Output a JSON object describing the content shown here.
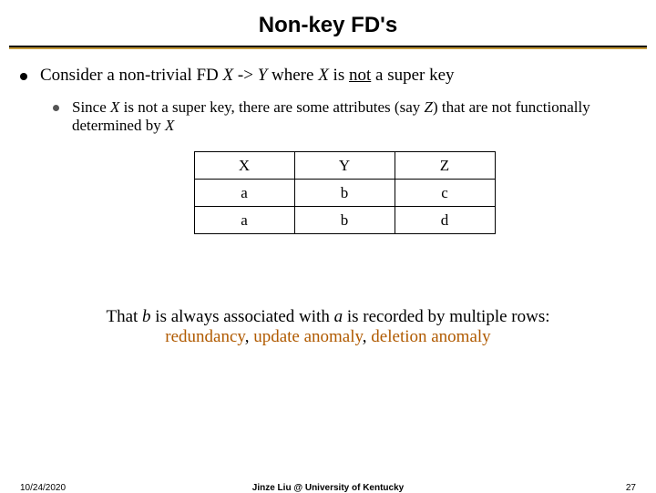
{
  "title": "Non-key FD's",
  "bullet1": {
    "pre": "Consider a non-trivial FD ",
    "x": "X",
    "arrow": " -> ",
    "y": "Y",
    "mid": " where ",
    "x2": "X",
    "is": " is ",
    "not": "not",
    "post": " a super key"
  },
  "bullet2": {
    "pre": "Since ",
    "x": "X",
    "mid1": " is not a super key, there are some attributes (say ",
    "z": "Z",
    "mid2": ") that are not functionally determined by ",
    "x2": "X"
  },
  "table": {
    "h": [
      "X",
      "Y",
      "Z"
    ],
    "r1": [
      "a",
      "b",
      "c"
    ],
    "r2": [
      "a",
      "b",
      "d"
    ]
  },
  "closing": {
    "line1a": "That ",
    "b": "b",
    "line1b": " is always associated with ",
    "a": "a",
    "line1c": " is recorded by multiple rows:",
    "a1": "redundancy",
    "sep1": ", ",
    "a2": "update anomaly",
    "sep2": ", ",
    "a3": "deletion anomaly"
  },
  "footer": {
    "date": "10/24/2020",
    "credit": "Jinze Liu @ University of Kentucky",
    "page": "27"
  },
  "chart_data": {
    "type": "table",
    "title": "Non-key FD example",
    "columns": [
      "X",
      "Y",
      "Z"
    ],
    "rows": [
      [
        "a",
        "b",
        "c"
      ],
      [
        "a",
        "b",
        "d"
      ]
    ]
  }
}
